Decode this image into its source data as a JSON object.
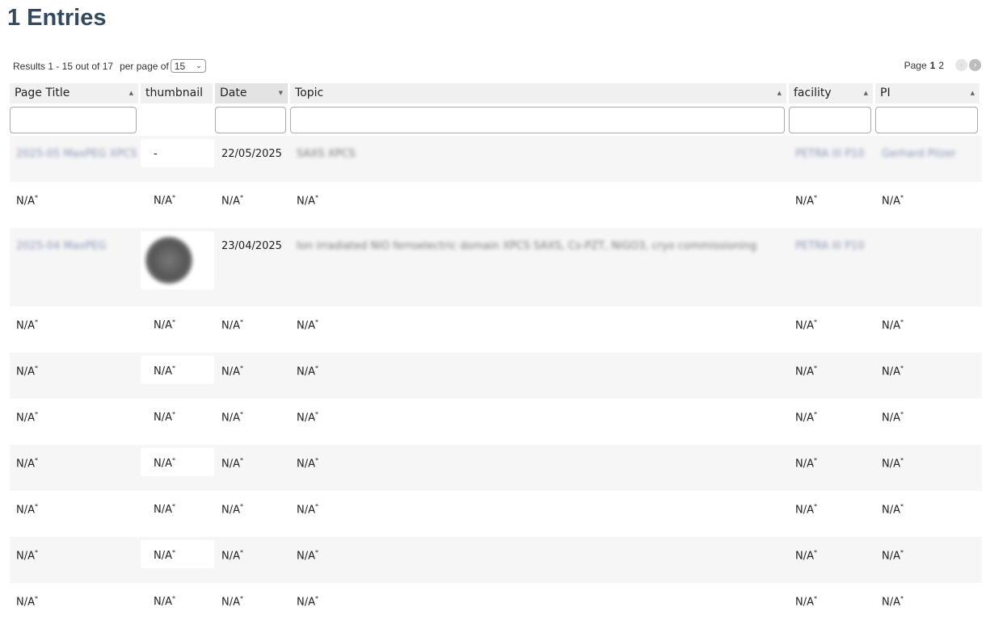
{
  "page": {
    "title": "1 Entries"
  },
  "results": {
    "text": "Results 1 - 15 out of 17",
    "per_page_label": "per page of",
    "per_page_value": "15"
  },
  "pager": {
    "label": "Page",
    "current": "1",
    "next": "2"
  },
  "columns": [
    {
      "label": "Page Title"
    },
    {
      "label": "thumbnail"
    },
    {
      "label": "Date"
    },
    {
      "label": "Topic"
    },
    {
      "label": "facility"
    },
    {
      "label": "PI"
    }
  ],
  "rows": [
    {
      "title": "2025-05 MaxPEG XPCS",
      "thumb": "-",
      "date": "22/05/2025",
      "topic": "SAXS XPCS",
      "facility": "PETRA III P10",
      "pi": "Gerhard Pilzer"
    },
    {
      "title": "N/A",
      "thumb": "N/A",
      "date": "N/A",
      "topic": "N/A",
      "facility": "N/A",
      "pi": "N/A"
    },
    {
      "title": "2025-04 MaxPEG",
      "thumb": "",
      "date": "23/04/2025",
      "topic": "Ion irradiated NiO ferroelectric domain XPCS SAXS, Cs-PZT, NiGO3, cryo commissioning",
      "facility": "PETRA III P10",
      "pi": ""
    },
    {
      "title": "N/A",
      "thumb": "N/A",
      "date": "N/A",
      "topic": "N/A",
      "facility": "N/A",
      "pi": "N/A"
    },
    {
      "title": "N/A",
      "thumb": "N/A",
      "date": "N/A",
      "topic": "N/A",
      "facility": "N/A",
      "pi": "N/A"
    },
    {
      "title": "N/A",
      "thumb": "N/A",
      "date": "N/A",
      "topic": "N/A",
      "facility": "N/A",
      "pi": "N/A"
    },
    {
      "title": "N/A",
      "thumb": "N/A",
      "date": "N/A",
      "topic": "N/A",
      "facility": "N/A",
      "pi": "N/A"
    },
    {
      "title": "N/A",
      "thumb": "N/A",
      "date": "N/A",
      "topic": "N/A",
      "facility": "N/A",
      "pi": "N/A"
    },
    {
      "title": "N/A",
      "thumb": "N/A",
      "date": "N/A",
      "topic": "N/A",
      "facility": "N/A",
      "pi": "N/A"
    },
    {
      "title": "N/A",
      "thumb": "N/A",
      "date": "N/A",
      "topic": "N/A",
      "facility": "N/A",
      "pi": "N/A"
    }
  ],
  "colors": {
    "title": "#34495e",
    "link": "#8a94b6",
    "header_bg": "#f0f0f0"
  }
}
